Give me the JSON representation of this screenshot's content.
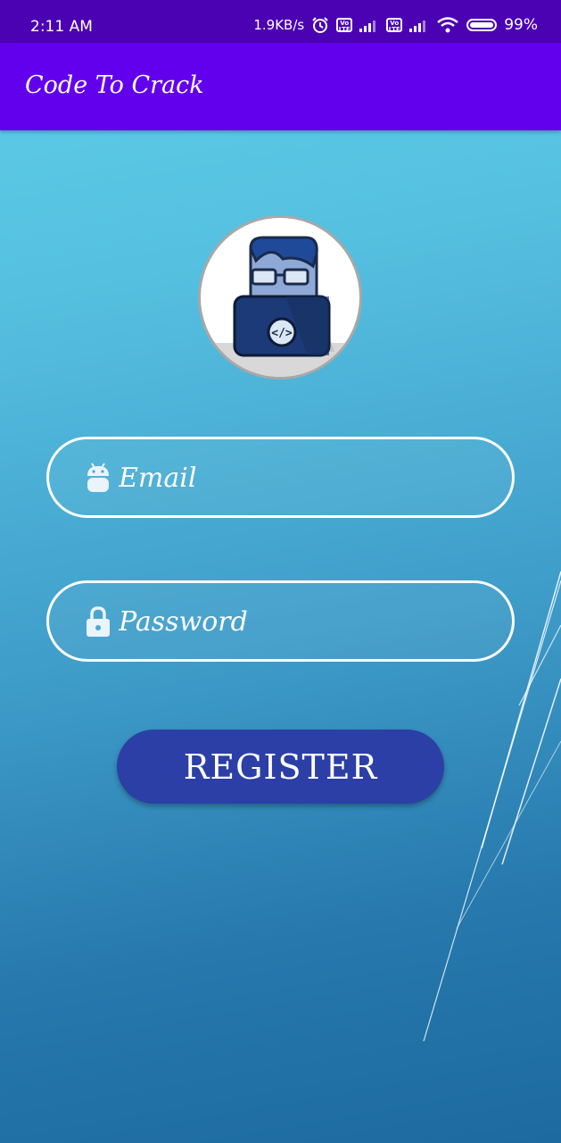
{
  "status_bar": {
    "time": "2:11 AM",
    "network_speed": "1.9KB/s",
    "battery_percent": "99%",
    "battery_level": 0.99,
    "icons": [
      "alarm-icon",
      "volte-icon",
      "signal-icon",
      "volte-icon",
      "signal-icon",
      "wifi-icon",
      "battery-icon"
    ],
    "volte_label": "Vo LTE"
  },
  "app_bar": {
    "title": "Code To Crack"
  },
  "form": {
    "avatar": "developer-avatar",
    "email": {
      "placeholder": "Email",
      "value": "",
      "icon": "android-icon"
    },
    "password": {
      "placeholder": "Password",
      "value": "",
      "icon": "lock-icon"
    },
    "register_label": "REGISTER"
  },
  "colors": {
    "status_bar": "#4a02b3",
    "app_bar": "#6200ee",
    "button": "#2c3fa6",
    "background_top": "#5fcfe9",
    "background_bottom": "#1d6aa0"
  }
}
